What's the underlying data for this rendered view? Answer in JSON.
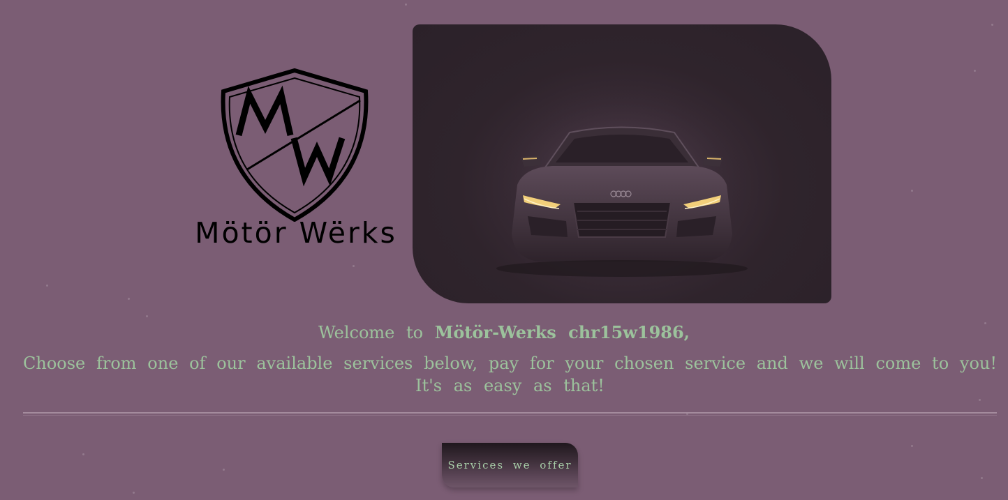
{
  "logo": {
    "monogram": "MW",
    "text": "Mötör Wërks"
  },
  "hero": {
    "icon": "sports-car-image"
  },
  "welcome": {
    "prefix": "Welcome to",
    "brand_user": "Mötör-Werks chr15w1986,"
  },
  "intro": {
    "line1": "Choose from one of our available services below, pay for your chosen service and we will come to you!",
    "line2": "It's as easy as that!"
  },
  "services_button": {
    "label": "Services we offer"
  },
  "colors": {
    "background": "#7b5d74",
    "text_accent": "#9cc29c",
    "hero_dark": "#2f242c"
  }
}
